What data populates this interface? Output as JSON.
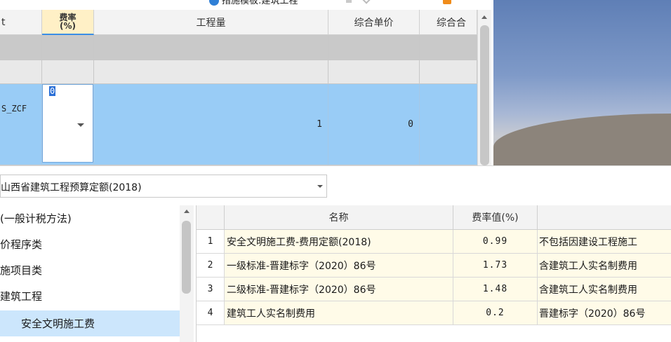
{
  "top_toolbar": {
    "title_text": "措施模板:建筑工程"
  },
  "top_grid": {
    "columns": {
      "left_partial": "t",
      "rate_line1": "费率",
      "rate_line2": "(%)",
      "quantity": "工程量",
      "unit_price": "综合单价",
      "total_partial": "综合合"
    },
    "active_row": {
      "code": "S_ZCF",
      "rate_value": "0",
      "quantity": "1",
      "unit_price": "0"
    }
  },
  "bottom_panel": {
    "quota_select": "山西省建筑工程预算定额(2018)",
    "tree": [
      {
        "label": "(一般计税方法)",
        "selected": false
      },
      {
        "label": "价程序类",
        "selected": false
      },
      {
        "label": "施项目类",
        "selected": false
      },
      {
        "label": "建筑工程",
        "selected": false
      },
      {
        "label": "安全文明施工费",
        "selected": true
      }
    ],
    "fee_table": {
      "headers": {
        "index": "",
        "name": "名称",
        "rate": "费率值(%)",
        "remark": ""
      },
      "rows": [
        {
          "index": "1",
          "name": "安全文明施工费-费用定额(2018)",
          "rate": "0.99",
          "remark": "不包括因建设工程施工"
        },
        {
          "index": "2",
          "name": "一级标准-晋建标字（2020）86号",
          "rate": "1.73",
          "remark": "含建筑工人实名制费用"
        },
        {
          "index": "3",
          "name": "二级标准-晋建标字（2020）86号",
          "rate": "1.48",
          "remark": "含建筑工人实名制费用"
        },
        {
          "index": "4",
          "name": "建筑工人实名制费用",
          "rate": "0.2",
          "remark": "晋建标字（2020）86号"
        }
      ]
    }
  },
  "colors": {
    "selected_row": "#99ccf6",
    "rate_header": "#fff0c6",
    "tree_selected": "#cce6fc",
    "fee_value_bg": "#fffbe8"
  }
}
